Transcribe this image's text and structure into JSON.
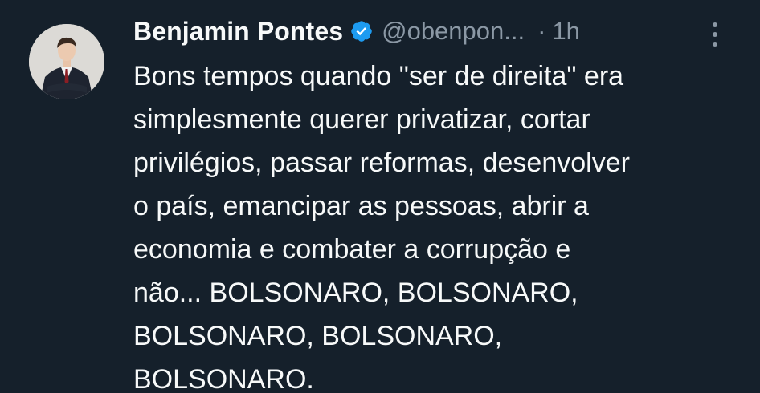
{
  "tweet": {
    "author": {
      "display_name": "Benjamin Pontes",
      "handle": "@obenpon...",
      "verified_icon": "verified-badge-icon",
      "avatar_icon": "profile-photo"
    },
    "separator": "·",
    "timestamp": "1h",
    "more_icon": "more-options-icon",
    "lines": [
      "Bons tempos quando \"ser de direita\" era",
      "simplesmente querer privatizar, cortar",
      "privilégios, passar reformas, desenvolver",
      "o país, emancipar as pessoas, abrir a",
      "economia e combater a corrupção e",
      "não... BOLSONARO, BOLSONARO,",
      "BOLSONARO, BOLSONARO,",
      "BOLSONARO."
    ]
  },
  "colors": {
    "background": "#15202b",
    "text_primary": "#f7f9f9",
    "text_secondary": "#8b98a5",
    "verified_blue": "#1d9bf0"
  }
}
